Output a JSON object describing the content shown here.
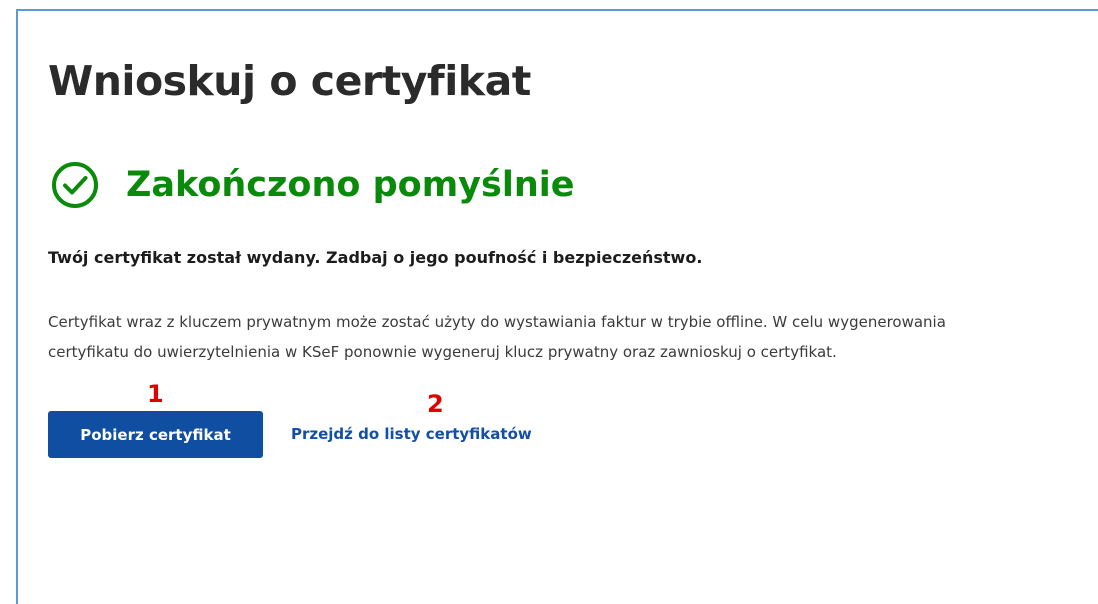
{
  "header": {
    "title": "Wnioskuj o certyfikat"
  },
  "status": {
    "icon": "check-circle-icon",
    "color": "#0a8a0a",
    "text": "Zakończono pomyślnie"
  },
  "content": {
    "lead": "Twój certyfikat został wydany. Zadbaj o jego poufność i bezpieczeństwo.",
    "description_lines": [
      "Certyfikat wraz z kluczem prywatnym może zostać użyty do wystawiania faktur w trybie offline. W celu wygenerowania",
      "certyfikatu do uwierzytelnienia w KSeF ponownie wygeneruj klucz prywatny oraz zawnioskuj o certyfikat."
    ]
  },
  "actions": {
    "download_label": "Pobierz certyfikat",
    "list_link_label": "Przejdź do listy certyfikatów",
    "primary_color": "#0f4ea0",
    "link_color": "#124fa6"
  },
  "annotations": {
    "marker_1": "1",
    "marker_2": "2",
    "color": "#e00000"
  }
}
